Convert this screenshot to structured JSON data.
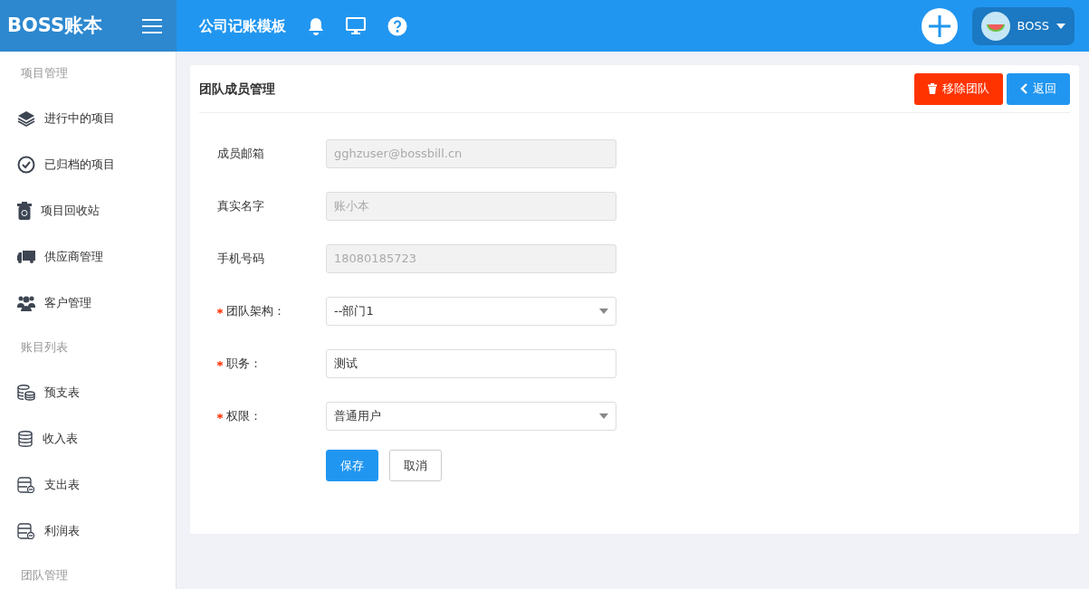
{
  "header": {
    "logo": "BOSS账本",
    "title": "公司记账模板",
    "user": "BOSS"
  },
  "sidebar": [
    {
      "heading": "项目管理",
      "items": [
        {
          "label": "进行中的项目"
        },
        {
          "label": "已归档的项目"
        },
        {
          "label": "项目回收站"
        },
        {
          "label": "供应商管理"
        },
        {
          "label": "客户管理"
        }
      ]
    },
    {
      "heading": "账目列表",
      "items": [
        {
          "label": "预支表"
        },
        {
          "label": "收入表"
        },
        {
          "label": "支出表"
        },
        {
          "label": "利润表"
        }
      ]
    },
    {
      "heading": "团队管理"
    }
  ],
  "card": {
    "title": "团队成员管理",
    "actions": [
      {
        "label": "移除团队",
        "kind": "danger"
      },
      {
        "label": "返回",
        "kind": "back"
      }
    ],
    "fields": [
      {
        "label": "成员邮箱",
        "kind": "input",
        "value": "gghzuser@bossbill.cn",
        "disabled": true,
        "required": false
      },
      {
        "label": "真实名字",
        "kind": "input",
        "value": "账小本",
        "disabled": true,
        "required": false
      },
      {
        "label": "手机号码",
        "kind": "input",
        "value": "18080185723",
        "disabled": true,
        "required": false
      },
      {
        "label": "团队架构：",
        "kind": "select",
        "value": "--部门1",
        "disabled": false,
        "required": true
      },
      {
        "label": "职务：",
        "kind": "input",
        "value": "测试",
        "disabled": false,
        "required": true
      },
      {
        "label": "权限：",
        "kind": "select",
        "value": "普通用户",
        "disabled": false,
        "required": true
      }
    ],
    "buttons": [
      {
        "label": "保存",
        "kind": "primary"
      },
      {
        "label": "取消",
        "kind": "default"
      }
    ]
  }
}
